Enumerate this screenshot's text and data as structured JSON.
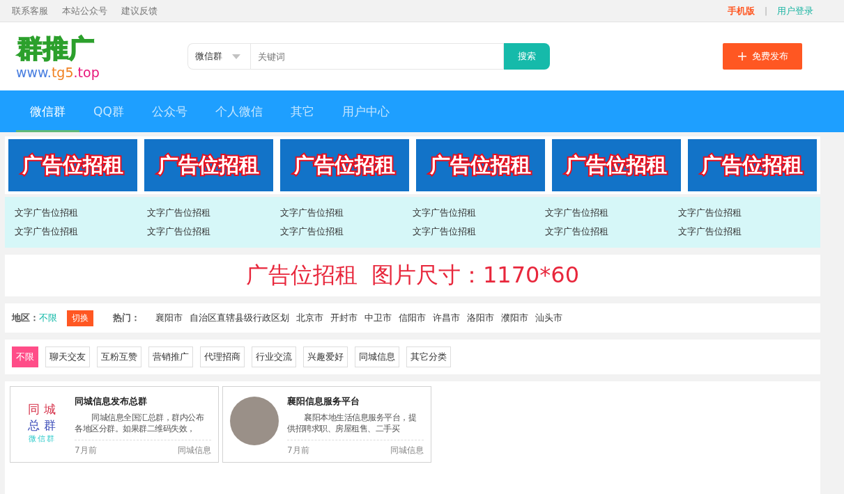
{
  "top_bar": {
    "left_links": [
      "联系客服",
      "本站公众号",
      "建议反馈"
    ],
    "mobile_link": "手机版",
    "separator": "|",
    "login_link": "用户登录"
  },
  "logo": {
    "title": "群推广",
    "url_parts": [
      "www.",
      "tg5",
      ".top"
    ]
  },
  "search": {
    "type_select": "微信群",
    "placeholder": "关键词",
    "button": "搜索"
  },
  "publish_button": "免费发布",
  "nav": [
    {
      "label": "微信群",
      "selected": true
    },
    {
      "label": "QQ群",
      "selected": false
    },
    {
      "label": "公众号",
      "selected": false
    },
    {
      "label": "个人微信",
      "selected": false
    },
    {
      "label": "其它",
      "selected": false
    },
    {
      "label": "用户中心",
      "selected": false
    }
  ],
  "image_ads": [
    "广告位招租",
    "广告位招租",
    "广告位招租",
    "广告位招租",
    "广告位招租",
    "广告位招租"
  ],
  "text_ads": [
    "文字广告位招租",
    "文字广告位招租",
    "文字广告位招租",
    "文字广告位招租",
    "文字广告位招租",
    "文字广告位招租",
    "文字广告位招租",
    "文字广告位招租",
    "文字广告位招租",
    "文字广告位招租",
    "文字广告位招租",
    "文字广告位招租"
  ],
  "wide_ad": {
    "title": "广告位招租",
    "size": "图片尺寸：1170*60"
  },
  "region_filter": {
    "label": "地区：",
    "value": "不限",
    "switch_button": "切换",
    "hot_label": "热门：",
    "cities": [
      "襄阳市",
      "自治区直辖县级行政区划",
      "北京市",
      "开封市",
      "中卫市",
      "信阳市",
      "许昌市",
      "洛阳市",
      "濮阳市",
      "汕头市"
    ]
  },
  "categories": [
    {
      "label": "不限",
      "selected": true
    },
    {
      "label": "聊天交友",
      "selected": false
    },
    {
      "label": "互粉互赞",
      "selected": false
    },
    {
      "label": "营销推广",
      "selected": false
    },
    {
      "label": "代理招商",
      "selected": false
    },
    {
      "label": "行业交流",
      "selected": false
    },
    {
      "label": "兴趣爱好",
      "selected": false
    },
    {
      "label": "同城信息",
      "selected": false
    },
    {
      "label": "其它分类",
      "selected": false
    }
  ],
  "groups": [
    {
      "kind": "text_logo",
      "logo_lines": [
        "同 城",
        "总 群",
        "微信群"
      ],
      "title": "同城信息发布总群",
      "description": "同城信息全国汇总群，群内公布各地区分群。如果群二维码失效，",
      "time": "7月前",
      "category": "同城信息"
    },
    {
      "kind": "photo",
      "title": "襄阳信息服务平台",
      "description": "襄阳本地生活信息服务平台，提供招聘求职、房屋租售、二手买",
      "time": "7月前",
      "category": "同城信息"
    }
  ]
}
